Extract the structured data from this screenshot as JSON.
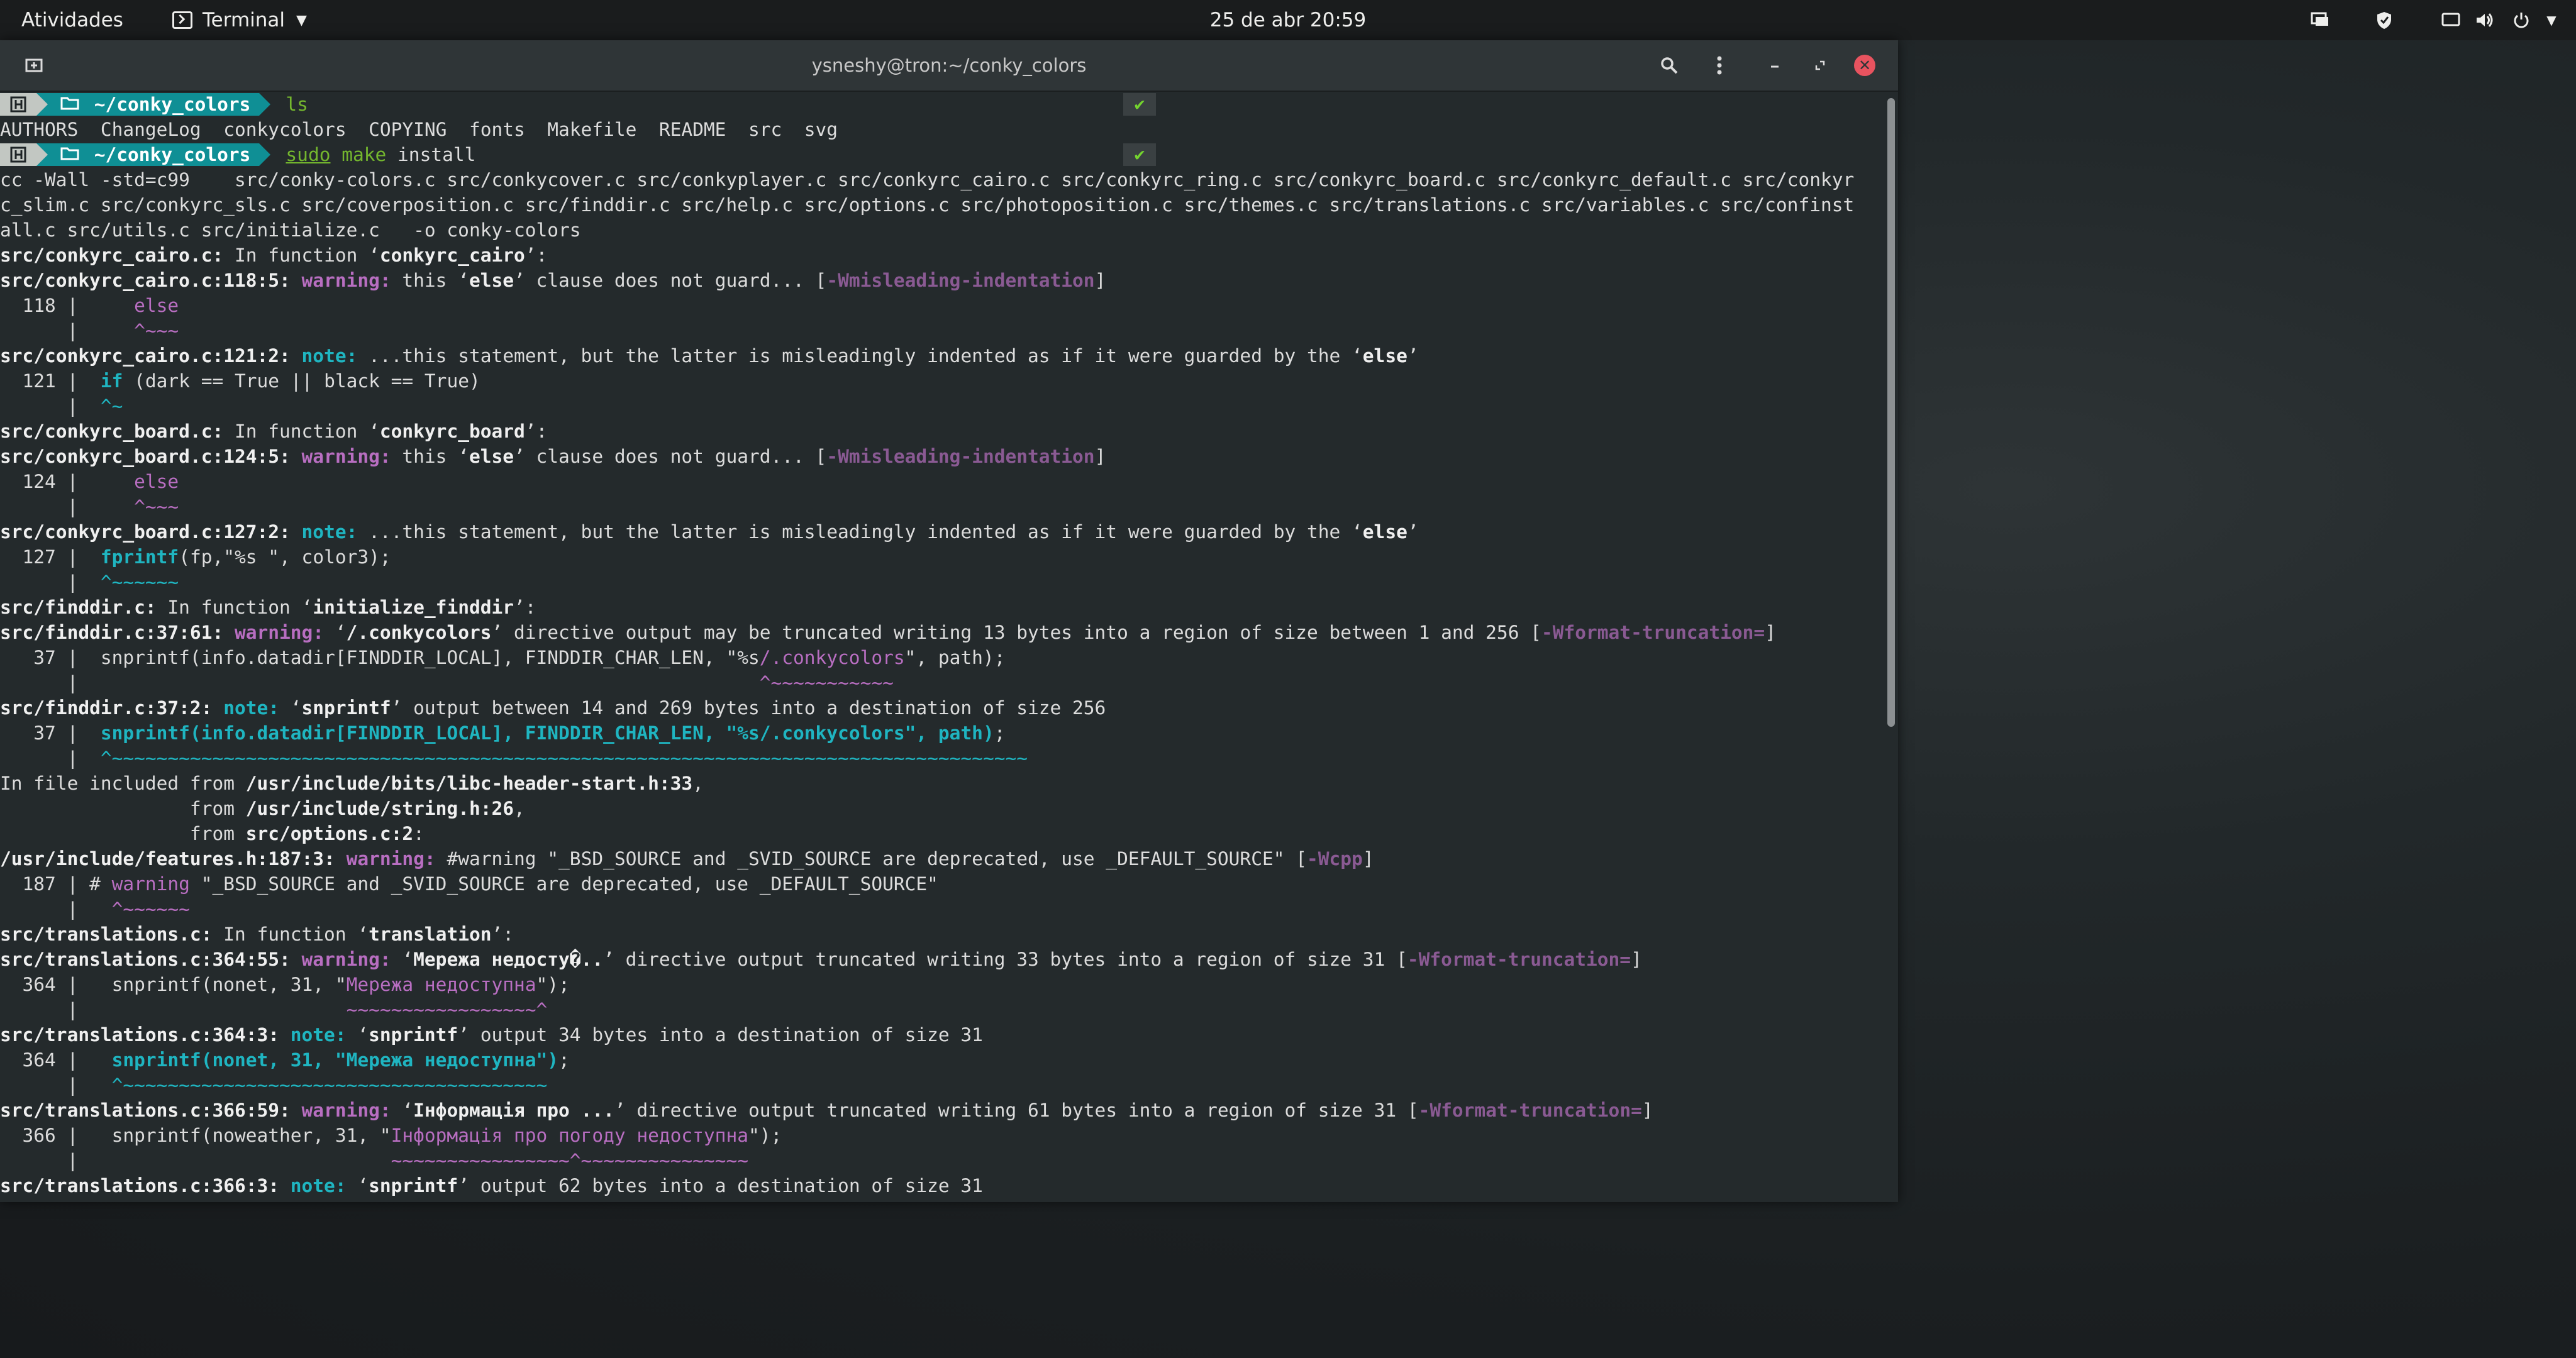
{
  "topbar": {
    "activities": "Atividades",
    "app_name": "Terminal",
    "clock": "25 de abr  20:59",
    "tray_icons": [
      "screen-icon",
      "shield-icon",
      "display-icon",
      "volume-icon",
      "power-icon"
    ]
  },
  "window": {
    "title": "ysneshy@tron:~/conky_colors",
    "buttons": [
      "new-tab-icon",
      "search-icon",
      "menu-icon",
      "minimize-icon",
      "maximize-icon",
      "close-icon"
    ]
  },
  "prompt": {
    "host_badge": " ",
    "dir": " ~/conky_colors",
    "check": "✔"
  },
  "lines": [
    {
      "t": "prompt",
      "cmd": [
        {
          "c": "g",
          "s": "ls"
        }
      ]
    },
    {
      "t": "text",
      "s": [
        {
          "s": "AUTHORS  ChangeLog  conkycolors  COPYING  fonts  Makefile  README  src  svg"
        }
      ]
    },
    {
      "t": "prompt",
      "cmd": [
        {
          "c": "gu",
          "s": "sudo"
        },
        {
          "s": " "
        },
        {
          "c": "g",
          "s": "make"
        },
        {
          "s": " install"
        }
      ]
    },
    {
      "t": "text",
      "s": [
        {
          "s": "cc -Wall -std=c99    src/conky-colors.c src/conkycover.c src/conkyplayer.c src/conkyrc_cairo.c src/conkyrc_ring.c src/conkyrc_board.c src/conkyrc_default.c src/conkyr"
        }
      ]
    },
    {
      "t": "text",
      "s": [
        {
          "s": "c_slim.c src/conkyrc_sls.c src/coverposition.c src/finddir.c src/help.c src/options.c src/photoposition.c src/themes.c src/translations.c src/variables.c src/confinst"
        }
      ]
    },
    {
      "t": "text",
      "s": [
        {
          "s": "all.c src/utils.c src/initialize.c   -o conky-colors"
        }
      ]
    },
    {
      "t": "text",
      "s": [
        {
          "c": "b",
          "s": "src/conkyrc_cairo.c:"
        },
        {
          "s": " In function ‘"
        },
        {
          "c": "b",
          "s": "conkyrc_cairo"
        },
        {
          "s": "’:"
        }
      ]
    },
    {
      "t": "text",
      "s": [
        {
          "c": "b",
          "s": "src/conkyrc_cairo.c:118:5:"
        },
        {
          "c": "w",
          "s": " warning: "
        },
        {
          "s": "this ‘"
        },
        {
          "c": "b",
          "s": "else"
        },
        {
          "s": "’ clause does not guard... ["
        },
        {
          "c": "f",
          "s": "-Wmisleading-indentation"
        },
        {
          "s": "]"
        }
      ]
    },
    {
      "t": "text",
      "s": [
        {
          "s": "  118 |     "
        },
        {
          "c": "q",
          "s": "else"
        }
      ]
    },
    {
      "t": "text",
      "s": [
        {
          "s": "      |     "
        },
        {
          "c": "q",
          "s": "^~~~"
        }
      ]
    },
    {
      "t": "text",
      "s": [
        {
          "c": "b",
          "s": "src/conkyrc_cairo.c:121:2:"
        },
        {
          "c": "n",
          "s": " note: "
        },
        {
          "s": "...this statement, but the latter is misleadingly indented as if it were guarded by the ‘"
        },
        {
          "c": "b",
          "s": "else"
        },
        {
          "s": "’"
        }
      ]
    },
    {
      "t": "text",
      "s": [
        {
          "s": "  121 |  "
        },
        {
          "c": "cb",
          "s": "if"
        },
        {
          "s": " (dark == True || black == True)"
        }
      ]
    },
    {
      "t": "text",
      "s": [
        {
          "s": "      |  "
        },
        {
          "c": "c",
          "s": "^~"
        }
      ]
    },
    {
      "t": "text",
      "s": [
        {
          "c": "b",
          "s": "src/conkyrc_board.c:"
        },
        {
          "s": " In function ‘"
        },
        {
          "c": "b",
          "s": "conkyrc_board"
        },
        {
          "s": "’:"
        }
      ]
    },
    {
      "t": "text",
      "s": [
        {
          "c": "b",
          "s": "src/conkyrc_board.c:124:5:"
        },
        {
          "c": "w",
          "s": " warning: "
        },
        {
          "s": "this ‘"
        },
        {
          "c": "b",
          "s": "else"
        },
        {
          "s": "’ clause does not guard... ["
        },
        {
          "c": "f",
          "s": "-Wmisleading-indentation"
        },
        {
          "s": "]"
        }
      ]
    },
    {
      "t": "text",
      "s": [
        {
          "s": "  124 |     "
        },
        {
          "c": "q",
          "s": "else"
        }
      ]
    },
    {
      "t": "text",
      "s": [
        {
          "s": "      |     "
        },
        {
          "c": "q",
          "s": "^~~~"
        }
      ]
    },
    {
      "t": "text",
      "s": [
        {
          "c": "b",
          "s": "src/conkyrc_board.c:127:2:"
        },
        {
          "c": "n",
          "s": " note: "
        },
        {
          "s": "...this statement, but the latter is misleadingly indented as if it were guarded by the ‘"
        },
        {
          "c": "b",
          "s": "else"
        },
        {
          "s": "’"
        }
      ]
    },
    {
      "t": "text",
      "s": [
        {
          "s": "  127 |  "
        },
        {
          "c": "cb",
          "s": "fprintf"
        },
        {
          "s": "(fp,\"%s \", color3);"
        }
      ]
    },
    {
      "t": "text",
      "s": [
        {
          "s": "      |  "
        },
        {
          "c": "c",
          "s": "^~~~~~~"
        }
      ]
    },
    {
      "t": "text",
      "s": [
        {
          "c": "b",
          "s": "src/finddir.c:"
        },
        {
          "s": " In function ‘"
        },
        {
          "c": "b",
          "s": "initialize_finddir"
        },
        {
          "s": "’:"
        }
      ]
    },
    {
      "t": "text",
      "s": [
        {
          "c": "b",
          "s": "src/finddir.c:37:61:"
        },
        {
          "c": "w",
          "s": " warning: "
        },
        {
          "s": "‘"
        },
        {
          "c": "b",
          "s": "/.conkycolors"
        },
        {
          "s": "’ directive output may be truncated writing 13 bytes into a region of size between 1 and 256 ["
        },
        {
          "c": "f",
          "s": "-Wformat-truncation="
        },
        {
          "s": "]"
        }
      ]
    },
    {
      "t": "text",
      "s": [
        {
          "s": "   37 |  snprintf(info.datadir[FINDDIR_LOCAL], FINDDIR_CHAR_LEN, \"%s"
        },
        {
          "c": "q",
          "s": "/.conkycolors"
        },
        {
          "s": "\", path);"
        }
      ]
    },
    {
      "t": "text",
      "s": [
        {
          "s": "      |                                                             "
        },
        {
          "c": "q",
          "s": "^~~~~~~~~~~~"
        }
      ]
    },
    {
      "t": "text",
      "s": [
        {
          "c": "b",
          "s": "src/finddir.c:37:2:"
        },
        {
          "c": "n",
          "s": " note: "
        },
        {
          "s": "‘"
        },
        {
          "c": "b",
          "s": "snprintf"
        },
        {
          "s": "’ output between 14 and 269 bytes into a destination of size 256"
        }
      ]
    },
    {
      "t": "text",
      "s": [
        {
          "s": "   37 |  "
        },
        {
          "c": "cb",
          "s": "snprintf(info.datadir[FINDDIR_LOCAL], FINDDIR_CHAR_LEN, \"%s/.conkycolors\", path)"
        },
        {
          "s": ";"
        }
      ]
    },
    {
      "t": "text",
      "s": [
        {
          "s": "      |  "
        },
        {
          "c": "c",
          "s": "^~~~~~~~~~~~~~~~~~~~~~~~~~~~~~~~~~~~~~~~~~~~~~~~~~~~~~~~~~~~~~~~~~~~~~~~~~~~~~~~~~~"
        }
      ]
    },
    {
      "t": "text",
      "s": [
        {
          "s": "In file included from "
        },
        {
          "c": "b",
          "s": "/usr/include/bits/libc-header-start.h:33"
        },
        {
          "s": ","
        }
      ]
    },
    {
      "t": "text",
      "s": [
        {
          "s": "                 from "
        },
        {
          "c": "b",
          "s": "/usr/include/string.h:26"
        },
        {
          "s": ","
        }
      ]
    },
    {
      "t": "text",
      "s": [
        {
          "s": "                 from "
        },
        {
          "c": "b",
          "s": "src/options.c:2"
        },
        {
          "s": ":"
        }
      ]
    },
    {
      "t": "text",
      "s": [
        {
          "c": "b",
          "s": "/usr/include/features.h:187:3:"
        },
        {
          "c": "w",
          "s": " warning: "
        },
        {
          "s": "#warning \"_BSD_SOURCE and _SVID_SOURCE are deprecated, use _DEFAULT_SOURCE\" ["
        },
        {
          "c": "f",
          "s": "-Wcpp"
        },
        {
          "s": "]"
        }
      ]
    },
    {
      "t": "text",
      "s": [
        {
          "s": "  187 | # "
        },
        {
          "c": "q",
          "s": "warning"
        },
        {
          "s": " \"_BSD_SOURCE and _SVID_SOURCE are deprecated, use _DEFAULT_SOURCE\""
        }
      ]
    },
    {
      "t": "text",
      "s": [
        {
          "s": "      |   "
        },
        {
          "c": "q",
          "s": "^~~~~~~"
        }
      ]
    },
    {
      "t": "text",
      "s": [
        {
          "c": "b",
          "s": "src/translations.c:"
        },
        {
          "s": " In function ‘"
        },
        {
          "c": "b",
          "s": "translation"
        },
        {
          "s": "’:"
        }
      ]
    },
    {
      "t": "text",
      "s": [
        {
          "c": "b",
          "s": "src/translations.c:364:55:"
        },
        {
          "c": "w",
          "s": " warning: "
        },
        {
          "s": "‘"
        },
        {
          "c": "b",
          "s": "Мережа недосту�.."
        },
        {
          "s": "’ directive output truncated writing 33 bytes into a region of size 31 ["
        },
        {
          "c": "f",
          "s": "-Wformat-truncation="
        },
        {
          "s": "]"
        }
      ]
    },
    {
      "t": "text",
      "s": [
        {
          "s": "  364 |   snprintf(nonet, 31, \""
        },
        {
          "c": "q",
          "s": "Мережа недоступна"
        },
        {
          "s": "\");"
        }
      ]
    },
    {
      "t": "text",
      "s": [
        {
          "s": "      |                        "
        },
        {
          "c": "q",
          "s": "~~~~~~~~~~~~~~~~~^"
        }
      ]
    },
    {
      "t": "text",
      "s": [
        {
          "c": "b",
          "s": "src/translations.c:364:3:"
        },
        {
          "c": "n",
          "s": " note: "
        },
        {
          "s": "‘"
        },
        {
          "c": "b",
          "s": "snprintf"
        },
        {
          "s": "’ output 34 bytes into a destination of size 31"
        }
      ]
    },
    {
      "t": "text",
      "s": [
        {
          "s": "  364 |   "
        },
        {
          "c": "cb",
          "s": "snprintf(nonet, 31, \"Мережа недоступна\")"
        },
        {
          "s": ";"
        }
      ]
    },
    {
      "t": "text",
      "s": [
        {
          "s": "      |   "
        },
        {
          "c": "c",
          "s": "^~~~~~~~~~~~~~~~~~~~~~~~~~~~~~~~~~~~~~~"
        }
      ]
    },
    {
      "t": "text",
      "s": [
        {
          "c": "b",
          "s": "src/translations.c:366:59:"
        },
        {
          "c": "w",
          "s": " warning: "
        },
        {
          "s": "‘"
        },
        {
          "c": "b",
          "s": "Інформація про ..."
        },
        {
          "s": "’ directive output truncated writing 61 bytes into a region of size 31 ["
        },
        {
          "c": "f",
          "s": "-Wformat-truncation="
        },
        {
          "s": "]"
        }
      ]
    },
    {
      "t": "text",
      "s": [
        {
          "s": "  366 |   snprintf(noweather, 31, \""
        },
        {
          "c": "q",
          "s": "Інформація про погоду недоступна"
        },
        {
          "s": "\");"
        }
      ]
    },
    {
      "t": "text",
      "s": [
        {
          "s": "      |                            "
        },
        {
          "c": "q",
          "s": "~~~~~~~~~~~~~~~~^~~~~~~~~~~~~~~~"
        }
      ]
    },
    {
      "t": "text",
      "s": [
        {
          "c": "b",
          "s": "src/translations.c:366:3:"
        },
        {
          "c": "n",
          "s": " note: "
        },
        {
          "s": "‘"
        },
        {
          "c": "b",
          "s": "snprintf"
        },
        {
          "s": "’ output 62 bytes into a destination of size 31"
        }
      ]
    }
  ],
  "colors": {
    "desktop": "#1b1f21",
    "topbar": "#1a1c1d",
    "terminal_bg": "#242a2c",
    "titlebar": "#2f3537",
    "warning": "#b86ec1",
    "note": "#1fb5c1",
    "prompt_dir": "#0f8f95",
    "command": "#74b72e",
    "close_button": "#e8535f"
  }
}
